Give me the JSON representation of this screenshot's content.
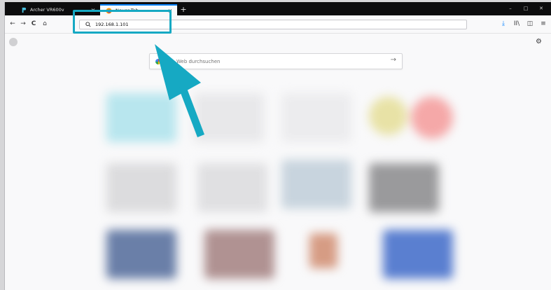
{
  "tabs": [
    {
      "label": "Archer VR600v",
      "close": "×",
      "favicon": "tp-link-icon"
    },
    {
      "label": "Neuer Tab",
      "close": "×",
      "favicon": "firefox-icon",
      "active": true
    }
  ],
  "new_tab": "+",
  "window_controls": {
    "minimize": "–",
    "maximize": "□",
    "close": "✕"
  },
  "nav": {
    "back": "←",
    "forward": "→",
    "reload": "C",
    "home": "⌂"
  },
  "url": {
    "value": "192.168.1.101"
  },
  "toolbar": {
    "download": "⤓",
    "library": "II\\",
    "sidebar": "◫",
    "menu": "≡"
  },
  "newtab_page": {
    "search_placeholder": "Web durchsuchen",
    "search_go": "→",
    "settings": "⚙"
  },
  "colors": {
    "highlight": "#16a9c3",
    "accent": "#0a84ff",
    "tab_bar": "#0c0c0d"
  }
}
